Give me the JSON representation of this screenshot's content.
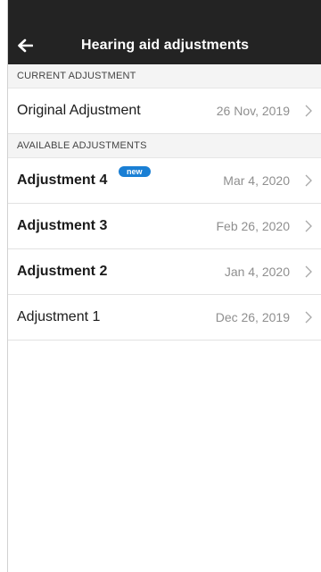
{
  "app_bar": {
    "title": "Hearing aid adjustments",
    "back_icon": "arrow-left-icon",
    "background": "#232323"
  },
  "current_section": {
    "header": "CURRENT ADJUSTMENT",
    "items": [
      {
        "label": "Original Adjustment",
        "date": "26 Nov, 2019",
        "bold": false,
        "badge": ""
      }
    ]
  },
  "available_section": {
    "header": "AVAILABLE ADJUSTMENTS",
    "items": [
      {
        "label": "Adjustment 4",
        "date": "Mar 4, 2020",
        "bold": true,
        "badge": "new"
      },
      {
        "label": "Adjustment 3",
        "date": "Feb 26, 2020",
        "bold": true,
        "badge": ""
      },
      {
        "label": "Adjustment 2",
        "date": "Jan 4, 2020",
        "bold": true,
        "badge": ""
      },
      {
        "label": "Adjustment 1",
        "date": "Dec 26, 2019",
        "bold": false,
        "badge": ""
      }
    ]
  },
  "colors": {
    "badge": "#1a7fd4",
    "date_text": "#8f8f8f",
    "section_header_bg": "#f4f4f4"
  },
  "icons": {
    "row_chevron": "chevron-right-icon"
  }
}
